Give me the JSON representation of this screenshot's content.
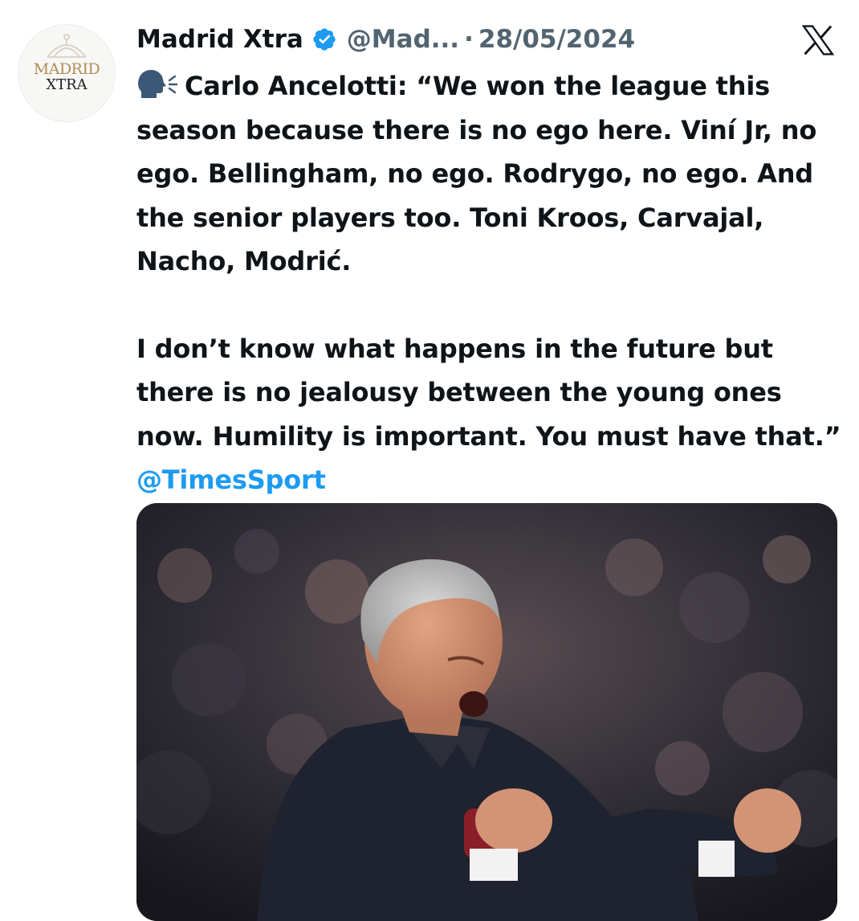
{
  "author": {
    "display_name": "Madrid Xtra",
    "handle": "@Mad...",
    "separator": "·",
    "date": "28/05/2024",
    "avatar": {
      "line1": "MADRID",
      "line2": "XTRA"
    },
    "verified_icon": "verified-badge-icon"
  },
  "platform_icon": "x-logo-icon",
  "tweet": {
    "speaker_icon": "speaking-head-icon",
    "paragraph1": "Carlo Ancelotti: “We won the league this season because there is no ego here. Viní Jr, no ego. Bellingham, no ego. Rodrygo, no ego. And the senior players too. Toni Kroos, Carvajal, Nacho, Modrić.",
    "paragraph2": "I don’t know what happens in the future but there is no jealousy between the young ones now. Humility is important. You must have that.”",
    "mention": "@TimesSport"
  },
  "media": {
    "kind": "photo"
  },
  "colors": {
    "text": "#0f1419",
    "secondary": "#536471",
    "link": "#1d9bf0",
    "verified": "#1d9bf0",
    "crest_gold": "#b08d57"
  }
}
